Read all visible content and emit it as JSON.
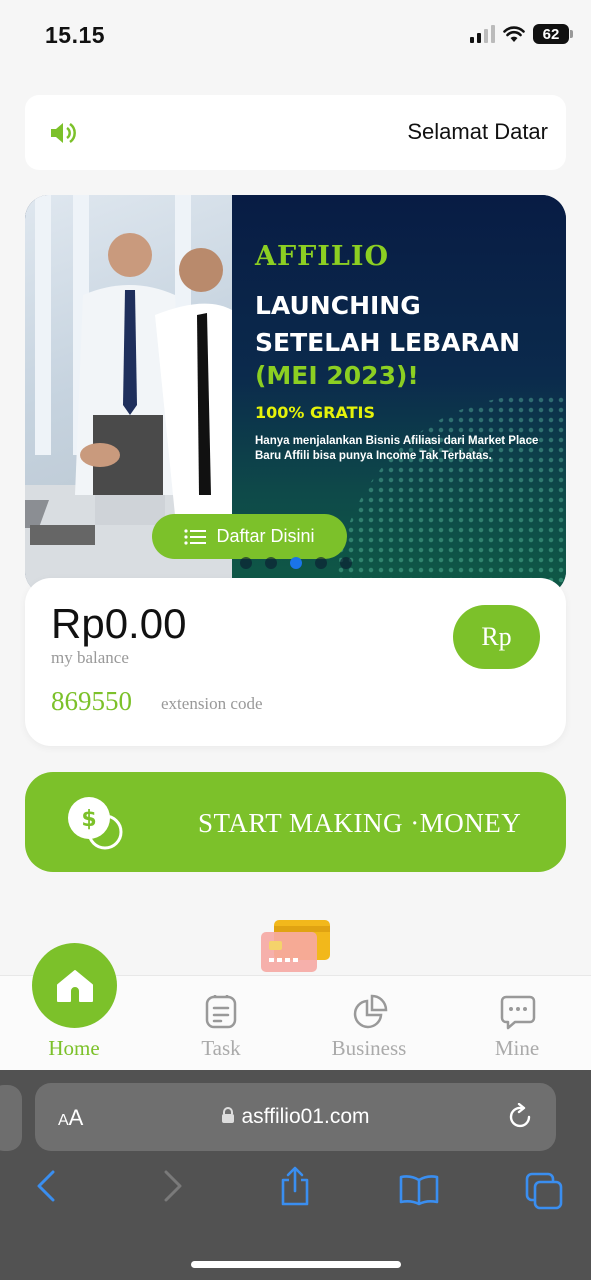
{
  "status": {
    "time": "15.15",
    "battery": "62"
  },
  "notice": {
    "text": "Selamat Datar"
  },
  "banner": {
    "brand": "AFFILIO",
    "headline_1": "LAUNCHING",
    "headline_2": "SETELAH LEBARAN",
    "headline_3": "(MEI 2023)!",
    "free": "100% GRATIS",
    "description": "Hanya menjalankan Bisnis Afiliasi dari Market Place Baru Affili bisa punya Income Tak Terbatas.",
    "cta": "Daftar Disini",
    "active_slide": 3,
    "slide_count": 5
  },
  "balance": {
    "amount": "Rp0.00",
    "label": "my balance",
    "code": "869550",
    "code_label": "extension code",
    "currency_button": "Rp"
  },
  "start": {
    "label": "START MAKING ·MONEY"
  },
  "tabs": [
    {
      "label": "Home",
      "active": true
    },
    {
      "label": "Task"
    },
    {
      "label": "Business"
    },
    {
      "label": "Mine"
    }
  ],
  "browser": {
    "aa": "AA",
    "url": "asffilio01.com"
  },
  "colors": {
    "accent": "#7cc12a",
    "banner_bg": "#0b2146",
    "banner_green": "#8ccf22"
  }
}
